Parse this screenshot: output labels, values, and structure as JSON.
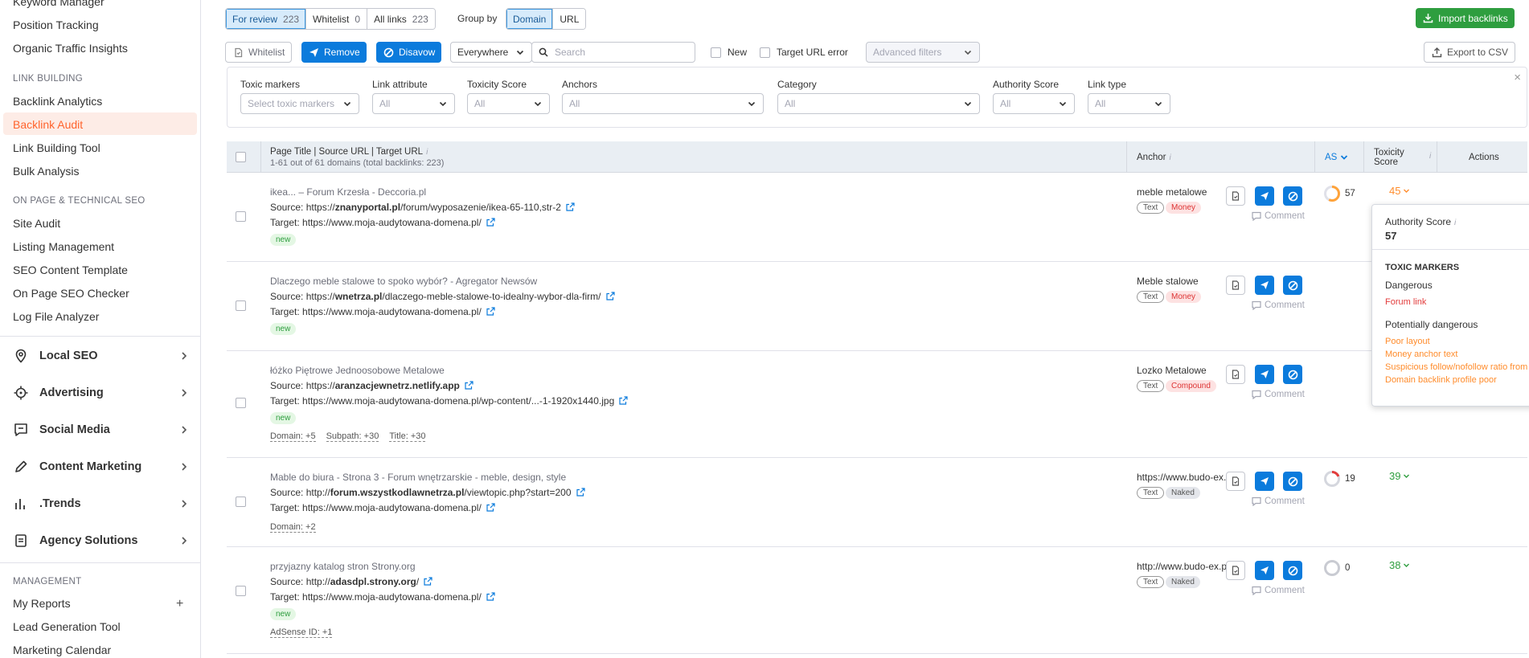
{
  "sidebar": {
    "top_items": [
      "Keyword Manager",
      "Position Tracking",
      "Organic Traffic Insights"
    ],
    "section_link_building": "LINK BUILDING",
    "link_building_items": [
      "Backlink Analytics",
      "Backlink Audit",
      "Link Building Tool",
      "Bulk Analysis"
    ],
    "active_item": "Backlink Audit",
    "section_onpage": "ON PAGE & TECHNICAL SEO",
    "onpage_items": [
      "Site Audit",
      "Listing Management",
      "SEO Content Template",
      "On Page SEO Checker",
      "Log File Analyzer"
    ],
    "groups": [
      {
        "label": "Local SEO",
        "icon": "location-pin-icon"
      },
      {
        "label": "Advertising",
        "icon": "target-icon"
      },
      {
        "label": "Social Media",
        "icon": "chat-bubble-icon"
      },
      {
        "label": "Content Marketing",
        "icon": "pencil-icon"
      },
      {
        "label": ".Trends",
        "icon": "bar-chart-icon"
      },
      {
        "label": "Agency Solutions",
        "icon": "document-icon"
      }
    ],
    "section_management": "MANAGEMENT",
    "management_items": [
      "My Reports",
      "Lead Generation Tool",
      "Marketing Calendar"
    ]
  },
  "toolbar": {
    "tabs": [
      {
        "label": "For review",
        "count": "223"
      },
      {
        "label": "Whitelist",
        "count": "0"
      },
      {
        "label": "All links",
        "count": "223"
      }
    ],
    "group_by_label": "Group by",
    "group_by_options": [
      "Domain",
      "URL"
    ],
    "import_label": "Import backlinks",
    "whitelist_label": "Whitelist",
    "remove_label": "Remove",
    "disavow_label": "Disavow",
    "scope_value": "Everywhere",
    "search_placeholder": "Search",
    "new_label": "New",
    "target_error_label": "Target URL error",
    "advanced_filters_label": "Advanced filters",
    "export_label": "Export to CSV"
  },
  "filters": [
    {
      "label": "Toxic markers",
      "value": "Select toxic markers"
    },
    {
      "label": "Link attribute",
      "value": "All"
    },
    {
      "label": "Toxicity Score",
      "value": "All"
    },
    {
      "label": "Anchors",
      "value": "All"
    },
    {
      "label": "Category",
      "value": "All"
    },
    {
      "label": "Authority Score",
      "value": "All"
    },
    {
      "label": "Link type",
      "value": "All"
    }
  ],
  "table": {
    "col_page": "Page Title | Source URL | Target URL",
    "col_page_sub": "1-61 out of 61 domains (total backlinks: 223)",
    "col_anchor": "Anchor",
    "col_as": "AS",
    "col_toxicity_1": "Toxicity",
    "col_toxicity_2": "Score",
    "col_actions": "Actions",
    "comment_label": "Comment",
    "rows": [
      {
        "title": "ikea... – Forum Krzesła - Deccoria.pl",
        "source_prefix": "Source: https://",
        "source_domain": "znanyportal.pl",
        "source_rest": "/forum/wyposazenie/ikea-65-110,str-2",
        "target": "Target: https://www.moja-audytowana-domena.pl/",
        "tag": "new",
        "anchor": "meble metalowe",
        "anchor_tags": [
          "Text",
          "Money"
        ],
        "as": "57",
        "as_level": 0.57,
        "toxicity": "45"
      },
      {
        "title": "Dlaczego meble stalowe to spoko wybór? - Agregator Newsów",
        "source_prefix": "Source: https://",
        "source_domain": "wnetrza.pl",
        "source_rest": "/dlaczego-meble-stalowe-to-idealny-wybor-dla-firm/",
        "target": "Target: https://www.moja-audytowana-domena.pl/",
        "tag": "new",
        "anchor": "Meble stalowe",
        "anchor_tags": [
          "Text",
          "Money"
        ],
        "as": "",
        "toxicity": ""
      },
      {
        "title": "łóżko Piętrowe Jednoosobowe Metalowe",
        "source_prefix": "Source: https://",
        "source_domain": "aranzacjewnetrz.netlify.app",
        "source_rest": "",
        "target": "Target: https://www.moja-audytowana-domena.pl/wp-content/...-1-1920x1440.jpg",
        "tag": "new",
        "deltas": [
          "Domain: +5",
          "Subpath: +30",
          "Title: +30"
        ],
        "anchor": "Lozko Metalowe",
        "anchor_tags": [
          "Text",
          "Compound"
        ],
        "as": "",
        "toxicity": ""
      },
      {
        "title": "Mable do biura - Strona 3 - Forum wnętrzarskie - meble, design, style",
        "source_prefix": "Source: http://",
        "source_domain": "forum.wszystkodlawnetrza.pl",
        "source_rest": "/viewtopic.php?start=200",
        "target": "Target: https://www.moja-audytowana-domena.pl/",
        "deltas": [
          "Domain: +2"
        ],
        "anchor": "https://www.budo-ex.pl/",
        "anchor_tags": [
          "Text",
          "Naked"
        ],
        "as": "19",
        "as_level": 0.19,
        "toxicity": "39"
      },
      {
        "title": "przyjazny katalog stron Strony.org",
        "source_prefix": "Source: http://",
        "source_domain": "adasdpl.strony.org",
        "source_rest": "/",
        "target": "Target: https://www.moja-audytowana-domena.pl/",
        "tag": "new",
        "deltas": [
          "AdSense ID: +1"
        ],
        "anchor": "http://www.budo-ex.pl",
        "anchor_tags": [
          "Text",
          "Naked"
        ],
        "as": "0",
        "as_level": 0.0,
        "toxicity": "38"
      }
    ]
  },
  "popover": {
    "title": "Authority Score",
    "value": "57",
    "section": "TOXIC MARKERS",
    "dangerous_label": "Dangerous",
    "dangerous_items": [
      "Forum link"
    ],
    "potential_label": "Potentially dangerous",
    "potential_items": [
      "Poor layout",
      "Money anchor text",
      "Suspicious follow/nofollow ratio from domain",
      "Domain backlink profile poor"
    ]
  },
  "colors": {
    "accent_blue": "#0b7bdc",
    "green": "#2e9e3f",
    "orange": "#ff8c2c",
    "active_orange": "#ff642d",
    "danger_red": "#e23c3c"
  }
}
